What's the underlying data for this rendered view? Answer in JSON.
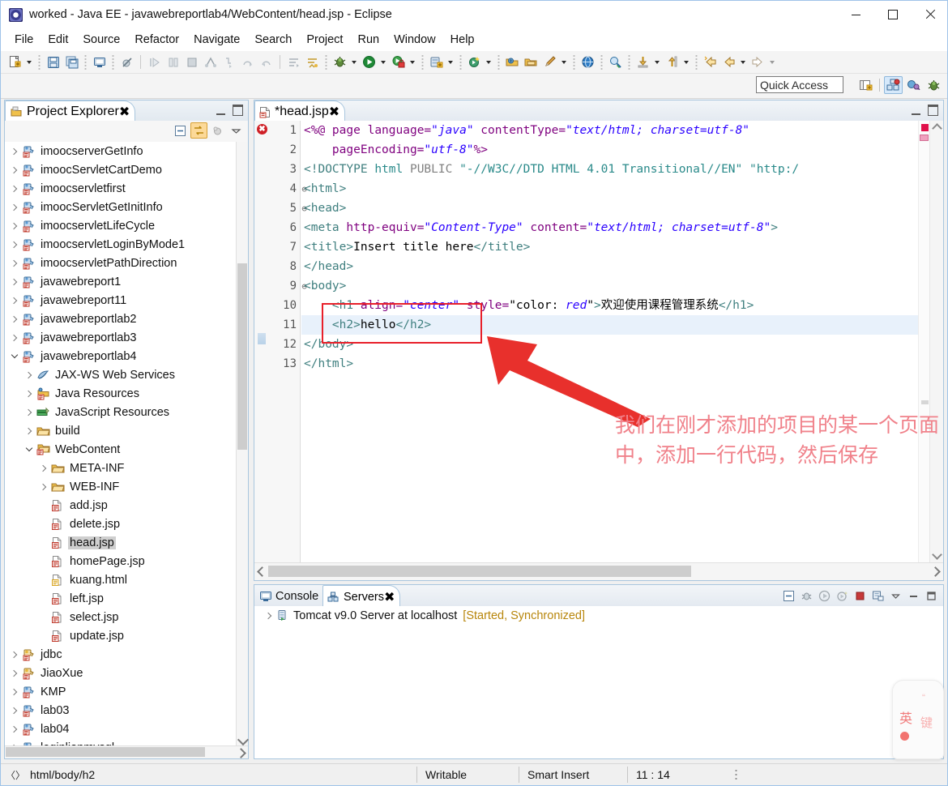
{
  "window": {
    "title": "worked - Java EE - javawebreportlab4/WebContent/head.jsp - Eclipse",
    "icon": "eclipse-icon",
    "minimize": "minimize-icon",
    "maximize": "maximize-icon",
    "close": "close-icon"
  },
  "menubar": {
    "items": [
      "File",
      "Edit",
      "Source",
      "Refactor",
      "Navigate",
      "Search",
      "Project",
      "Run",
      "Window",
      "Help"
    ]
  },
  "toolbar": {
    "groups": [
      {
        "items": [
          {
            "name": "new-wizard-icon",
            "arrow": true
          },
          {
            "name": "save-icon",
            "arrow": false
          },
          {
            "name": "save-all-icon",
            "arrow": false
          }
        ]
      },
      {
        "items": [
          {
            "name": "console-icon",
            "arrow": false
          }
        ]
      },
      {
        "items": [
          {
            "name": "skip-breakpoints-icon",
            "arrow": false
          }
        ]
      },
      {
        "items": [
          {
            "name": "resume-icon",
            "arrow": false
          },
          {
            "name": "suspend-icon",
            "arrow": false
          },
          {
            "name": "terminate-icon",
            "arrow": false
          },
          {
            "name": "disconnect-icon",
            "arrow": false
          },
          {
            "name": "step-into-icon",
            "arrow": false
          },
          {
            "name": "step-over-icon",
            "arrow": false
          },
          {
            "name": "step-return-icon",
            "arrow": false
          }
        ]
      },
      {
        "items": [
          {
            "name": "next-annotation-icon",
            "arrow": false
          },
          {
            "name": "previous-annotation-icon",
            "arrow": false
          }
        ]
      },
      {
        "items": [
          {
            "name": "debug-icon",
            "arrow": true
          },
          {
            "name": "run-icon",
            "arrow": true
          },
          {
            "name": "run-external-tools-icon",
            "arrow": true
          },
          {
            "name": "new-server-icon",
            "arrow": true
          },
          {
            "name": "coverage-icon",
            "arrow": true
          }
        ]
      },
      {
        "items": [
          {
            "name": "open-type-icon",
            "arrow": false
          },
          {
            "name": "open-task-icon",
            "arrow": false
          },
          {
            "name": "new-java-class-icon",
            "arrow": true
          }
        ]
      },
      {
        "items": [
          {
            "name": "web-browser-icon",
            "arrow": false
          }
        ]
      },
      {
        "items": [
          {
            "name": "search-icon",
            "arrow": false
          }
        ]
      },
      {
        "items": [
          {
            "name": "download-icon",
            "arrow": true
          },
          {
            "name": "upload-icon",
            "arrow": true
          }
        ]
      },
      {
        "items": [
          {
            "name": "back-history-icon",
            "arrow": false
          },
          {
            "name": "previous-edit-icon",
            "arrow": true
          },
          {
            "name": "forward-history-icon",
            "arrow": true
          }
        ]
      }
    ]
  },
  "quick_access": {
    "placeholder": "Quick Access",
    "value": "Quick Access",
    "open_perspective_icon": "open-perspective-icon",
    "perspectives": [
      {
        "name": "perspective-java-ee",
        "active": true
      },
      {
        "name": "perspective-java",
        "active": false
      },
      {
        "name": "perspective-debug",
        "active": false
      }
    ]
  },
  "explorer": {
    "tab_label": "Project Explorer",
    "tab_icon": "project-explorer-icon",
    "tab_close": "close-icon",
    "minimize_icon": "minimize-icon",
    "maximize_icon": "maximize-icon",
    "toolbar": [
      {
        "name": "collapse-all-icon",
        "active": false
      },
      {
        "name": "link-with-editor-icon",
        "active": true
      },
      {
        "name": "focus-on-active-task-icon",
        "active": false
      },
      {
        "name": "view-menu-icon",
        "active": false
      }
    ],
    "tree": [
      {
        "label": "imoocserverGetInfo",
        "indent": 0,
        "twist": "right",
        "icon": "dynamic-web-project-icon",
        "selected": false
      },
      {
        "label": "imoocServletCartDemo",
        "indent": 0,
        "twist": "right",
        "icon": "dynamic-web-project-icon",
        "selected": false
      },
      {
        "label": "imoocservletfirst",
        "indent": 0,
        "twist": "right",
        "icon": "dynamic-web-project-icon",
        "selected": false
      },
      {
        "label": "imoocServletGetInitInfo",
        "indent": 0,
        "twist": "right",
        "icon": "dynamic-web-project-icon",
        "selected": false
      },
      {
        "label": "imoocservletLifeCycle",
        "indent": 0,
        "twist": "right",
        "icon": "dynamic-web-project-icon",
        "selected": false
      },
      {
        "label": "imoocservletLoginByMode1",
        "indent": 0,
        "twist": "right",
        "icon": "dynamic-web-project-icon",
        "selected": false
      },
      {
        "label": "imoocservletPathDirection",
        "indent": 0,
        "twist": "right",
        "icon": "dynamic-web-project-icon",
        "selected": false
      },
      {
        "label": "javawebreport1",
        "indent": 0,
        "twist": "right",
        "icon": "dynamic-web-project-icon",
        "selected": false
      },
      {
        "label": "javawebreport11",
        "indent": 0,
        "twist": "right",
        "icon": "dynamic-web-project-icon",
        "selected": false
      },
      {
        "label": "javawebreportlab2",
        "indent": 0,
        "twist": "right",
        "icon": "dynamic-web-project-icon",
        "selected": false
      },
      {
        "label": "javawebreportlab3",
        "indent": 0,
        "twist": "right",
        "icon": "dynamic-web-project-icon",
        "selected": false
      },
      {
        "label": "javawebreportlab4",
        "indent": 0,
        "twist": "down",
        "icon": "dynamic-web-project-icon",
        "selected": false
      },
      {
        "label": "JAX-WS Web Services",
        "indent": 1,
        "twist": "right",
        "icon": "jaxws-icon",
        "selected": false
      },
      {
        "label": "Java Resources",
        "indent": 1,
        "twist": "right",
        "icon": "java-resources-icon",
        "selected": false
      },
      {
        "label": "JavaScript Resources",
        "indent": 1,
        "twist": "right",
        "icon": "javascript-resources-icon",
        "selected": false
      },
      {
        "label": "build",
        "indent": 1,
        "twist": "right",
        "icon": "folder-icon",
        "selected": false
      },
      {
        "label": "WebContent",
        "indent": 1,
        "twist": "down",
        "icon": "webcontent-folder-icon",
        "selected": false
      },
      {
        "label": "META-INF",
        "indent": 2,
        "twist": "right",
        "icon": "folder-icon",
        "selected": false
      },
      {
        "label": "WEB-INF",
        "indent": 2,
        "twist": "right",
        "icon": "folder-icon",
        "selected": false
      },
      {
        "label": "add.jsp",
        "indent": 2,
        "twist": "none",
        "icon": "jsp-file-icon",
        "selected": false
      },
      {
        "label": "delete.jsp",
        "indent": 2,
        "twist": "none",
        "icon": "jsp-file-icon",
        "selected": false
      },
      {
        "label": "head.jsp",
        "indent": 2,
        "twist": "none",
        "icon": "jsp-file-icon",
        "selected": true
      },
      {
        "label": "homePage.jsp",
        "indent": 2,
        "twist": "none",
        "icon": "jsp-file-icon",
        "selected": false
      },
      {
        "label": "kuang.html",
        "indent": 2,
        "twist": "none",
        "icon": "html-file-icon",
        "selected": false
      },
      {
        "label": "left.jsp",
        "indent": 2,
        "twist": "none",
        "icon": "jsp-file-icon",
        "selected": false
      },
      {
        "label": "select.jsp",
        "indent": 2,
        "twist": "none",
        "icon": "jsp-file-icon",
        "selected": false
      },
      {
        "label": "update.jsp",
        "indent": 2,
        "twist": "none",
        "icon": "jsp-file-icon",
        "selected": false
      },
      {
        "label": "jdbc",
        "indent": 0,
        "twist": "right",
        "icon": "java-project-icon",
        "selected": false
      },
      {
        "label": "JiaoXue",
        "indent": 0,
        "twist": "right",
        "icon": "java-project-icon",
        "selected": false
      },
      {
        "label": "KMP",
        "indent": 0,
        "twist": "right",
        "icon": "dynamic-web-project-icon",
        "selected": false
      },
      {
        "label": "lab03",
        "indent": 0,
        "twist": "right",
        "icon": "dynamic-web-project-icon",
        "selected": false
      },
      {
        "label": "lab04",
        "indent": 0,
        "twist": "right",
        "icon": "dynamic-web-project-icon",
        "selected": false
      },
      {
        "label": "loginlianmysql",
        "indent": 0,
        "twist": "right",
        "icon": "dynamic-web-project-icon",
        "selected": false
      }
    ]
  },
  "editor": {
    "tab_label": "*head.jsp",
    "tab_icon": "jsp-file-icon",
    "tab_close": "close-icon",
    "minimize_icon": "minimize-icon",
    "maximize_icon": "maximize-icon",
    "error_marker": "error-icon",
    "lines": [
      {
        "num": "1",
        "fold": "",
        "highlight": false,
        "parts": [
          {
            "t": "<%@",
            "c": "dir"
          },
          {
            "t": " page ",
            "c": "attr"
          },
          {
            "t": "language=",
            "c": "attr"
          },
          {
            "t": "\"java\"",
            "c": "val"
          },
          {
            "t": " contentType=",
            "c": "attr"
          },
          {
            "t": "\"text/html; charset=utf-8\"",
            "c": "val"
          }
        ]
      },
      {
        "num": "2",
        "fold": "",
        "highlight": false,
        "parts": [
          {
            "t": "    pageEncoding=",
            "c": "attr"
          },
          {
            "t": "\"utf-8\"",
            "c": "val"
          },
          {
            "t": "%>",
            "c": "dir"
          }
        ]
      },
      {
        "num": "3",
        "fold": "",
        "highlight": false,
        "parts": [
          {
            "t": "<!DOCTYPE ",
            "c": "tag"
          },
          {
            "t": "html ",
            "c": "teal"
          },
          {
            "t": "PUBLIC ",
            "c": "gray"
          },
          {
            "t": "\"-//W3C//DTD HTML 4.01 Transitional//EN\" \"http:/",
            "c": "teal"
          }
        ]
      },
      {
        "num": "4",
        "fold": "⊖",
        "highlight": false,
        "parts": [
          {
            "t": "<html>",
            "c": "tag"
          }
        ]
      },
      {
        "num": "5",
        "fold": "⊖",
        "highlight": false,
        "parts": [
          {
            "t": "<head>",
            "c": "tag"
          }
        ]
      },
      {
        "num": "6",
        "fold": "",
        "highlight": false,
        "parts": [
          {
            "t": "<meta ",
            "c": "tag"
          },
          {
            "t": "http-equiv=",
            "c": "attr"
          },
          {
            "t": "\"Content-Type\"",
            "c": "val"
          },
          {
            "t": " content=",
            "c": "attr"
          },
          {
            "t": "\"text/html; charset=utf-8\"",
            "c": "val"
          },
          {
            "t": ">",
            "c": "tag"
          }
        ]
      },
      {
        "num": "7",
        "fold": "",
        "highlight": false,
        "parts": [
          {
            "t": "<title>",
            "c": "tag"
          },
          {
            "t": "Insert title here",
            "c": "txt"
          },
          {
            "t": "</title>",
            "c": "tag"
          }
        ]
      },
      {
        "num": "8",
        "fold": "",
        "highlight": false,
        "parts": [
          {
            "t": "</head>",
            "c": "tag"
          }
        ]
      },
      {
        "num": "9",
        "fold": "⊖",
        "highlight": false,
        "parts": [
          {
            "t": "<body>",
            "c": "tag"
          }
        ]
      },
      {
        "num": "10",
        "fold": "",
        "highlight": false,
        "parts": [
          {
            "t": "    <h1 ",
            "c": "tag"
          },
          {
            "t": "align=",
            "c": "attr"
          },
          {
            "t": "\"center\"",
            "c": "val"
          },
          {
            "t": " style=",
            "c": "attr"
          },
          {
            "t": "\"color: ",
            "c": "txt"
          },
          {
            "t": "red",
            "c": "val"
          },
          {
            "t": "\"",
            "c": "txt"
          },
          {
            "t": ">",
            "c": "tag"
          },
          {
            "t": "欢迎使用课程管理系统",
            "c": "txt"
          },
          {
            "t": "</h1>",
            "c": "tag"
          }
        ]
      },
      {
        "num": "11",
        "fold": "",
        "highlight": true,
        "parts": [
          {
            "t": "    <h2>",
            "c": "tag"
          },
          {
            "t": "hello",
            "c": "txt"
          },
          {
            "t": "</h2>",
            "c": "tag"
          }
        ]
      },
      {
        "num": "12",
        "fold": "",
        "highlight": false,
        "parts": [
          {
            "t": "</body>",
            "c": "tag"
          }
        ]
      },
      {
        "num": "13",
        "fold": "",
        "highlight": false,
        "parts": [
          {
            "t": "</html>",
            "c": "tag"
          }
        ]
      }
    ],
    "annotation": {
      "text": "我们在刚才添加的项目的某一个页面中，添加一行代码，然后保存",
      "color": "#f0818a",
      "highlight_box_color": "#e8202a",
      "arrow_color": "#e8202a"
    }
  },
  "console": {
    "tabs": [
      {
        "label": "Console",
        "icon": "console-icon",
        "active": false,
        "close": false
      },
      {
        "label": "Servers",
        "icon": "servers-icon",
        "active": true,
        "close": true
      }
    ],
    "tools": [
      {
        "name": "collapse-all-icon"
      },
      {
        "name": "debug-server-icon"
      },
      {
        "name": "start-server-icon"
      },
      {
        "name": "profile-server-icon"
      },
      {
        "name": "stop-server-icon"
      },
      {
        "name": "publish-server-icon"
      },
      {
        "name": "view-menu-icon"
      },
      {
        "name": "minimize-icon"
      },
      {
        "name": "maximize-icon"
      }
    ],
    "rows": [
      {
        "twist": "right",
        "icon": "tomcat-server-icon",
        "name": "Tomcat v9.0 Server at localhost",
        "status": "[Started, Synchronized]"
      }
    ]
  },
  "statusbar": {
    "path_icon": "code-path-icon",
    "path": "html/body/h2",
    "writable": "Writable",
    "insert_mode": "Smart Insert",
    "position": "11 : 14",
    "more_icon": "more-vertical-icon"
  },
  "ime": {
    "mode_label": "英",
    "secondary_label": "键",
    "dot_icon": "ime-dot-icon",
    "quote_icon": "ime-quote-icon"
  }
}
